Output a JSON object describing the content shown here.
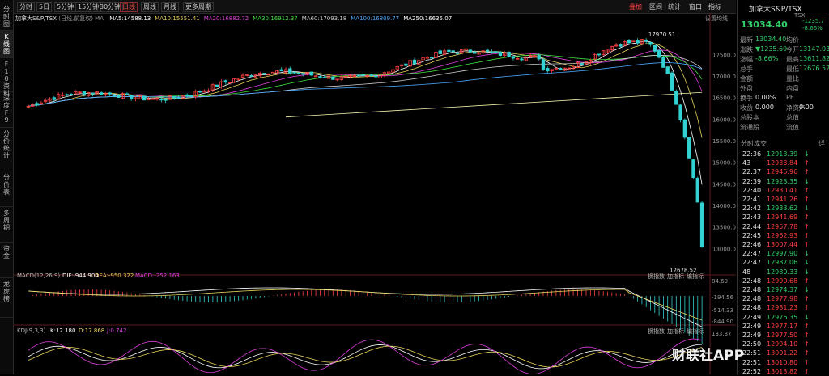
{
  "rail": [
    "分时图",
    "K线图",
    "F10资料",
    "深度F9",
    "分价统计",
    "分价表",
    "多周期",
    "资金",
    "龙虎榜"
  ],
  "toolbar": {
    "periods": [
      "分时",
      "5日",
      "5分钟",
      "15分钟",
      "30分钟",
      "日线",
      "周线",
      "月线",
      "更多周期"
    ],
    "active_period": "日线",
    "right": {
      "overlay": "叠加",
      "stats": "区间",
      "stats2": "统计",
      "window": "窗口",
      "more": "指标"
    }
  },
  "chart": {
    "title": "加拿大S&P/TSX",
    "adj": "(日线,前复权)",
    "ma_header": "MA",
    "ma": [
      {
        "label": "MA5:14588.13",
        "color": "#ffffff"
      },
      {
        "label": "MA10:15551.41",
        "color": "#e8d25a"
      },
      {
        "label": "MA20:16882.72",
        "color": "#e040e0"
      },
      {
        "label": "MA30:16912.37",
        "color": "#40e040"
      },
      {
        "label": "MA60:17093.18",
        "color": "#cfcfcf"
      },
      {
        "label": "MA100:16809.77",
        "color": "#4aa8ff"
      },
      {
        "label": "MA250:16635.07",
        "color": "#ffffff"
      }
    ],
    "settings": "设置均线",
    "y_labels": [
      "17500.00",
      "17000.00",
      "16500.00",
      "16000.00",
      "15500.00",
      "15000.00",
      "14500.00",
      "14000.00",
      "13500.00",
      "13000.00"
    ],
    "high_label": "17970.51",
    "low_label": "12678.52",
    "macd": {
      "name": "MACD(12,26,9)",
      "dif": "DIF:-944.904",
      "dea": "DEA:-950.322",
      "macd": "MACD:-252.163",
      "y": [
        "84.69",
        "-194.56",
        "-514.33",
        "-844.90"
      ],
      "btns": [
        "换指数",
        "加指标",
        "编指标"
      ]
    },
    "kdj": {
      "name": "KDJ(9,3,3)",
      "k": "K:12.180",
      "d": "D:17.868",
      "j": "J:0.742",
      "y": [
        "133.37"
      ],
      "btns": [
        "换指数",
        "加指标",
        "编指标"
      ]
    },
    "chart_data": {
      "type": "candlestick",
      "title": "加拿大S&P/TSX",
      "ylim": [
        12500,
        18200
      ],
      "high": 17970.51,
      "low": 12678.52,
      "last_close": 13034.4
    }
  },
  "panel": {
    "title": "加拿大S&P/TSX",
    "code": "TSX",
    "price": "13034.40",
    "chg": "-1235.7",
    "pct": "-8.66%",
    "rows": [
      {
        "l": "最新",
        "v": "13034.40",
        "lc": "gray",
        "vc": "green",
        "l2": "均价",
        "v2": "",
        "v2c": "white"
      },
      {
        "l": "涨跌",
        "v": "▼1235.69",
        "lc": "gray",
        "vc": "green",
        "l2": "今开",
        "v2": "13147.03",
        "v2c": "green"
      },
      {
        "l": "涨幅",
        "v": "-8.66%",
        "lc": "gray",
        "vc": "green",
        "l2": "最高",
        "v2": "13611.82",
        "v2c": "green"
      },
      {
        "l": "总手",
        "v": "",
        "lc": "gray",
        "vc": "white",
        "l2": "最低",
        "v2": "12676.52",
        "v2c": "green"
      },
      {
        "l": "金额",
        "v": "",
        "lc": "gray",
        "vc": "white",
        "l2": "量比",
        "v2": "",
        "v2c": "white"
      },
      {
        "l": "外盘",
        "v": "",
        "lc": "gray",
        "vc": "white",
        "l2": "内盘",
        "v2": "",
        "v2c": "white"
      },
      {
        "l": "换手",
        "v": "0.00%",
        "lc": "gray",
        "vc": "white",
        "l2": "PE",
        "v2": "",
        "v2c": "white"
      },
      {
        "l": "收益",
        "v": "0.000",
        "lc": "gray",
        "vc": "white",
        "l2": "净资产",
        "v2": "0.00",
        "v2c": "white"
      },
      {
        "l": "总股本",
        "v": "",
        "lc": "gray",
        "vc": "white",
        "l2": "总值",
        "v2": "",
        "v2c": "white"
      },
      {
        "l": "流通股",
        "v": "",
        "lc": "gray",
        "vc": "white",
        "l2": "流值",
        "v2": "",
        "v2c": "white"
      }
    ],
    "ticks_title": "分时成交",
    "ticks_btn": "详",
    "ticks": [
      {
        "t": "22:36",
        "p": "12913.39",
        "d": "↓"
      },
      {
        "t": "43",
        "p": "12933.84",
        "d": "↑"
      },
      {
        "t": "22:37",
        "p": "12945.96",
        "d": "↑"
      },
      {
        "t": "22:39",
        "p": "12923.35",
        "d": "↓"
      },
      {
        "t": "22:40",
        "p": "12930.41",
        "d": "↑"
      },
      {
        "t": "22:41",
        "p": "12941.26",
        "d": "↑"
      },
      {
        "t": "22:42",
        "p": "12933.62",
        "d": "↓"
      },
      {
        "t": "22:43",
        "p": "12941.69",
        "d": "↑"
      },
      {
        "t": "22:44",
        "p": "12957.78",
        "d": "↑"
      },
      {
        "t": "22:45",
        "p": "12962.93",
        "d": "↑"
      },
      {
        "t": "22:46",
        "p": "13007.44",
        "d": "↑"
      },
      {
        "t": "22:47",
        "p": "12997.90",
        "d": "↓"
      },
      {
        "t": "22:47",
        "p": "12987.06",
        "d": "↓"
      },
      {
        "t": "48",
        "p": "12980.33",
        "d": "↓"
      },
      {
        "t": "22:48",
        "p": "12990.68",
        "d": "↑"
      },
      {
        "t": "22:48",
        "p": "12974.37",
        "d": "↓"
      },
      {
        "t": "22:48",
        "p": "12977.98",
        "d": "↑"
      },
      {
        "t": "22:48",
        "p": "12981.23",
        "d": "↑"
      },
      {
        "t": "22:49",
        "p": "12976.35",
        "d": "↓"
      },
      {
        "t": "22:49",
        "p": "12977.17",
        "d": "↑"
      },
      {
        "t": "22:49",
        "p": "12977.50",
        "d": "↑"
      },
      {
        "t": "22:50",
        "p": "12994.10",
        "d": "↑"
      },
      {
        "t": "22:51",
        "p": "13001.22",
        "d": "↑"
      },
      {
        "t": "22:51",
        "p": "13010.80",
        "d": "↑"
      },
      {
        "t": "22:52",
        "p": "13013.82",
        "d": "↑"
      }
    ]
  },
  "watermark": "财联社APP"
}
